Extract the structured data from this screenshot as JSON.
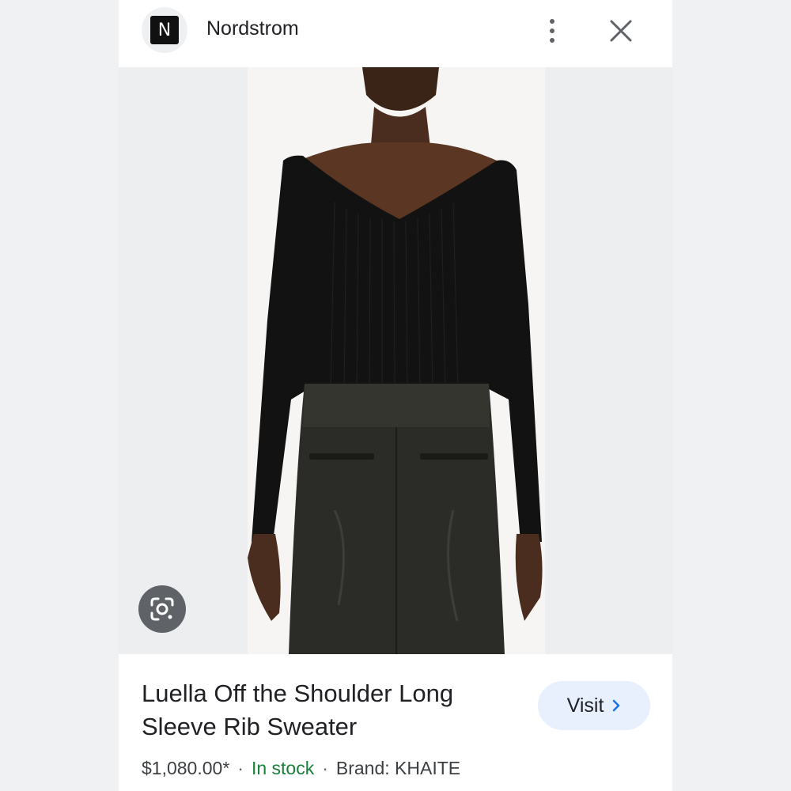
{
  "header": {
    "logo_letter": "N",
    "site_name": "Nordstrom",
    "more_icon": "more-vert-icon",
    "close_icon": "close-icon"
  },
  "image": {
    "lens_icon": "google-lens-icon"
  },
  "product": {
    "title": "Luella Off the Shoulder Long Sleeve Rib Sweater",
    "price": "$1,080.00*",
    "separator": "·",
    "availability": "In stock",
    "brand": "Brand: KHAITE"
  },
  "visit_button": {
    "label": "Visit"
  },
  "colors": {
    "accent_bg": "#e8f0fe",
    "accent_chevron": "#1a73e8",
    "in_stock": "#188038"
  }
}
